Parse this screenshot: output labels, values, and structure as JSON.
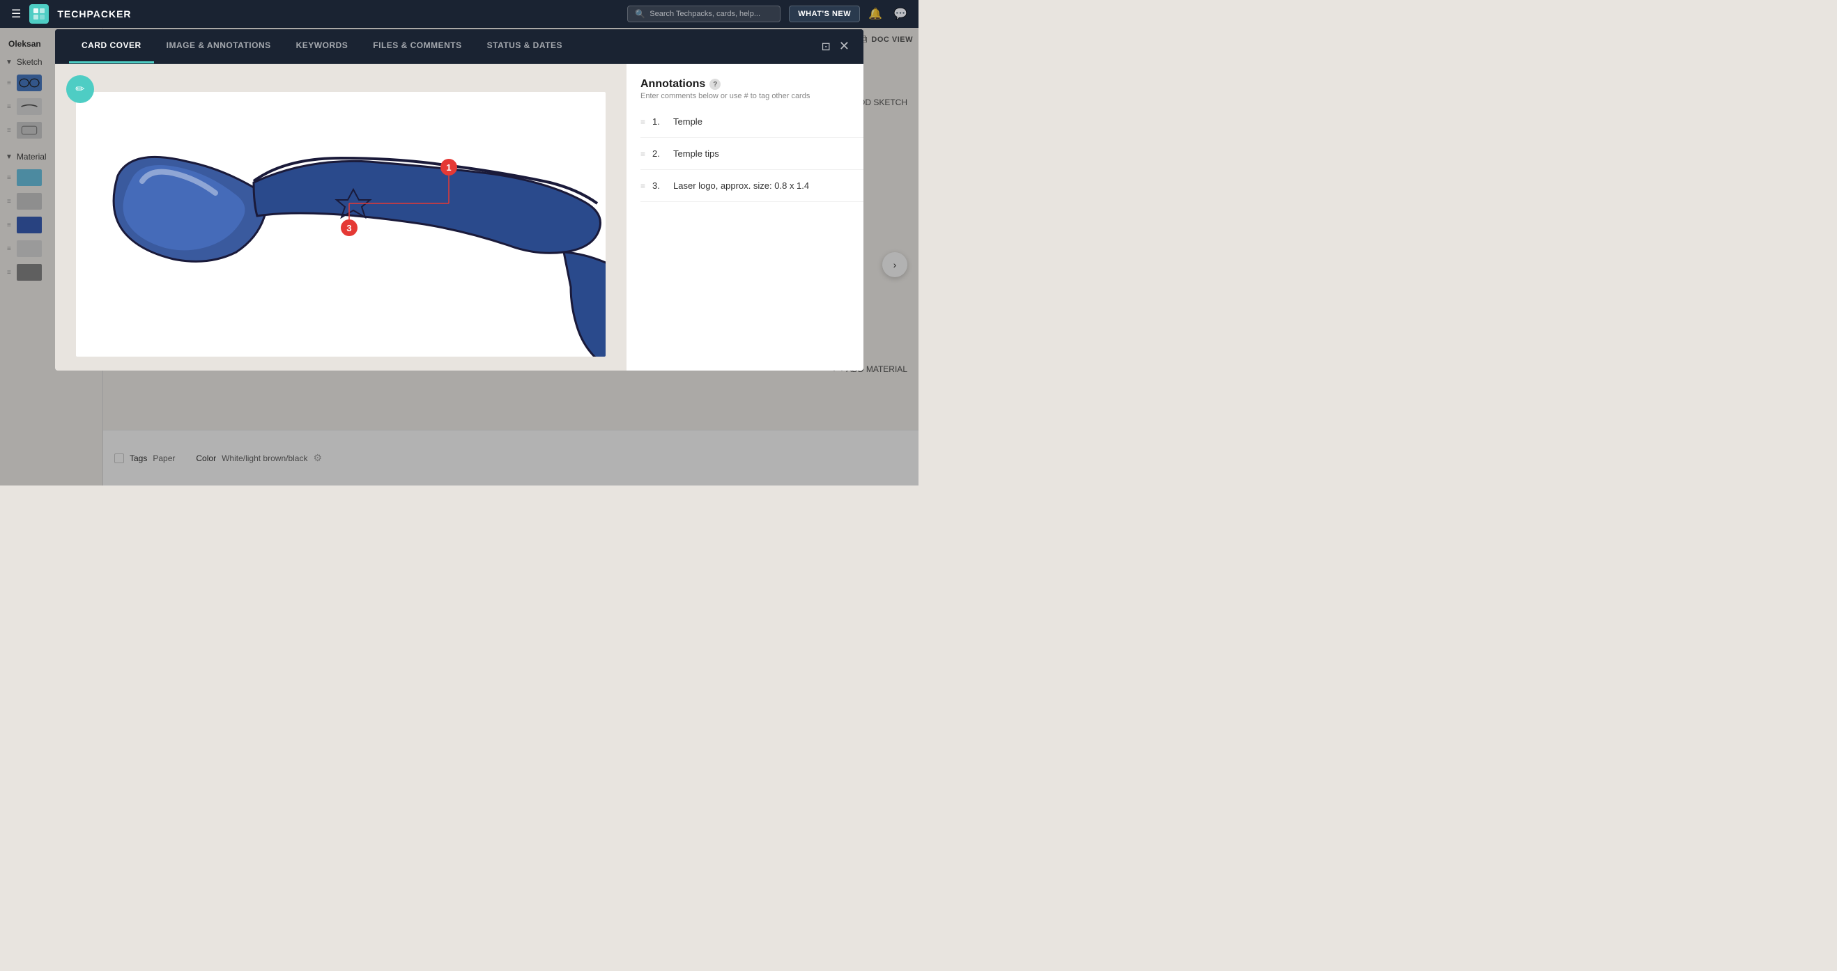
{
  "app": {
    "title": "TECHPACKER",
    "search_placeholder": "Search Techpacks, cards, help...",
    "whats_new": "WHAT'S NEW",
    "doc_view": "DOC VIEW"
  },
  "sidebar": {
    "user": "Oleksan",
    "sketch_section": "Sketch",
    "material_section": "Material",
    "add_sketch": "+ ADD SKETCH",
    "add_material": "+ ADD MATERIAL"
  },
  "modal": {
    "tabs": [
      {
        "id": "card-cover",
        "label": "CARD COVER",
        "active": true
      },
      {
        "id": "image-annotations",
        "label": "IMAGE & ANNOTATIONS",
        "active": false
      },
      {
        "id": "keywords",
        "label": "KEYWORDS",
        "active": false
      },
      {
        "id": "files-comments",
        "label": "FILES & COMMENTS",
        "active": false
      },
      {
        "id": "status-dates",
        "label": "STATUS & DATES",
        "active": false
      }
    ]
  },
  "annotations": {
    "title": "Annotations",
    "subtitle": "Enter comments below or use # to tag other cards",
    "items": [
      {
        "number": "1.",
        "text": "Temple"
      },
      {
        "number": "2.",
        "text": "Temple tips"
      },
      {
        "number": "3.",
        "text": "Laser logo, approx. size: 0.8 x 1.4"
      }
    ]
  },
  "bottom_table": {
    "rows": [
      {
        "label": "Tags",
        "value": "Paper",
        "col2_label": "Color",
        "col2_value": "White/light brown/black"
      }
    ]
  },
  "nav": {
    "prev": "‹",
    "next": "›"
  }
}
